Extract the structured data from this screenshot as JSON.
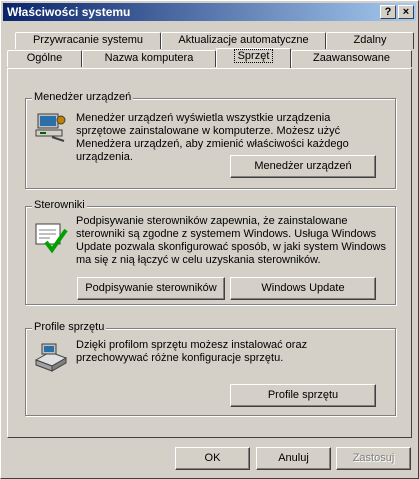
{
  "window": {
    "title": "Właściwości systemu",
    "help_button": "?",
    "close_button": "×"
  },
  "tabs": {
    "row_top": [
      {
        "label": "Przywracanie systemu"
      },
      {
        "label": "Aktualizacje automatyczne"
      },
      {
        "label": "Zdalny"
      }
    ],
    "row_bottom": [
      {
        "label": "Ogólne"
      },
      {
        "label": "Nazwa komputera"
      },
      {
        "label": "Sprzęt",
        "active": true
      },
      {
        "label": "Zaawansowane"
      }
    ]
  },
  "device_manager": {
    "title": "Menedżer urządzeń",
    "description": "Menedżer urządzeń wyświetla wszystkie urządzenia sprzętowe zainstalowane w komputerze. Możesz użyć Menedżera urządzeń, aby zmienić właściwości każdego urządzenia.",
    "button": "Menedżer urządzeń",
    "icon": "device-manager-icon"
  },
  "drivers": {
    "title": "Sterowniki",
    "description": "Podpisywanie sterowników zapewnia, że zainstalowane sterowniki są zgodne z systemem Windows. Usługa Windows Update pozwala skonfigurować sposób, w jaki system Windows ma się z nią łączyć w celu uzyskania sterowników.",
    "signing_button": "Podpisywanie sterowników",
    "update_button": "Windows Update",
    "icon": "driver-signing-icon"
  },
  "hardware_profiles": {
    "title": "Profile sprzętu",
    "description": "Dzięki profilom sprzętu możesz instalować oraz przechowywać różne konfiguracje sprzętu.",
    "button": "Profile sprzętu",
    "icon": "hardware-profile-icon"
  },
  "footer": {
    "ok": "OK",
    "cancel": "Anuluj",
    "apply": "Zastosuj"
  }
}
